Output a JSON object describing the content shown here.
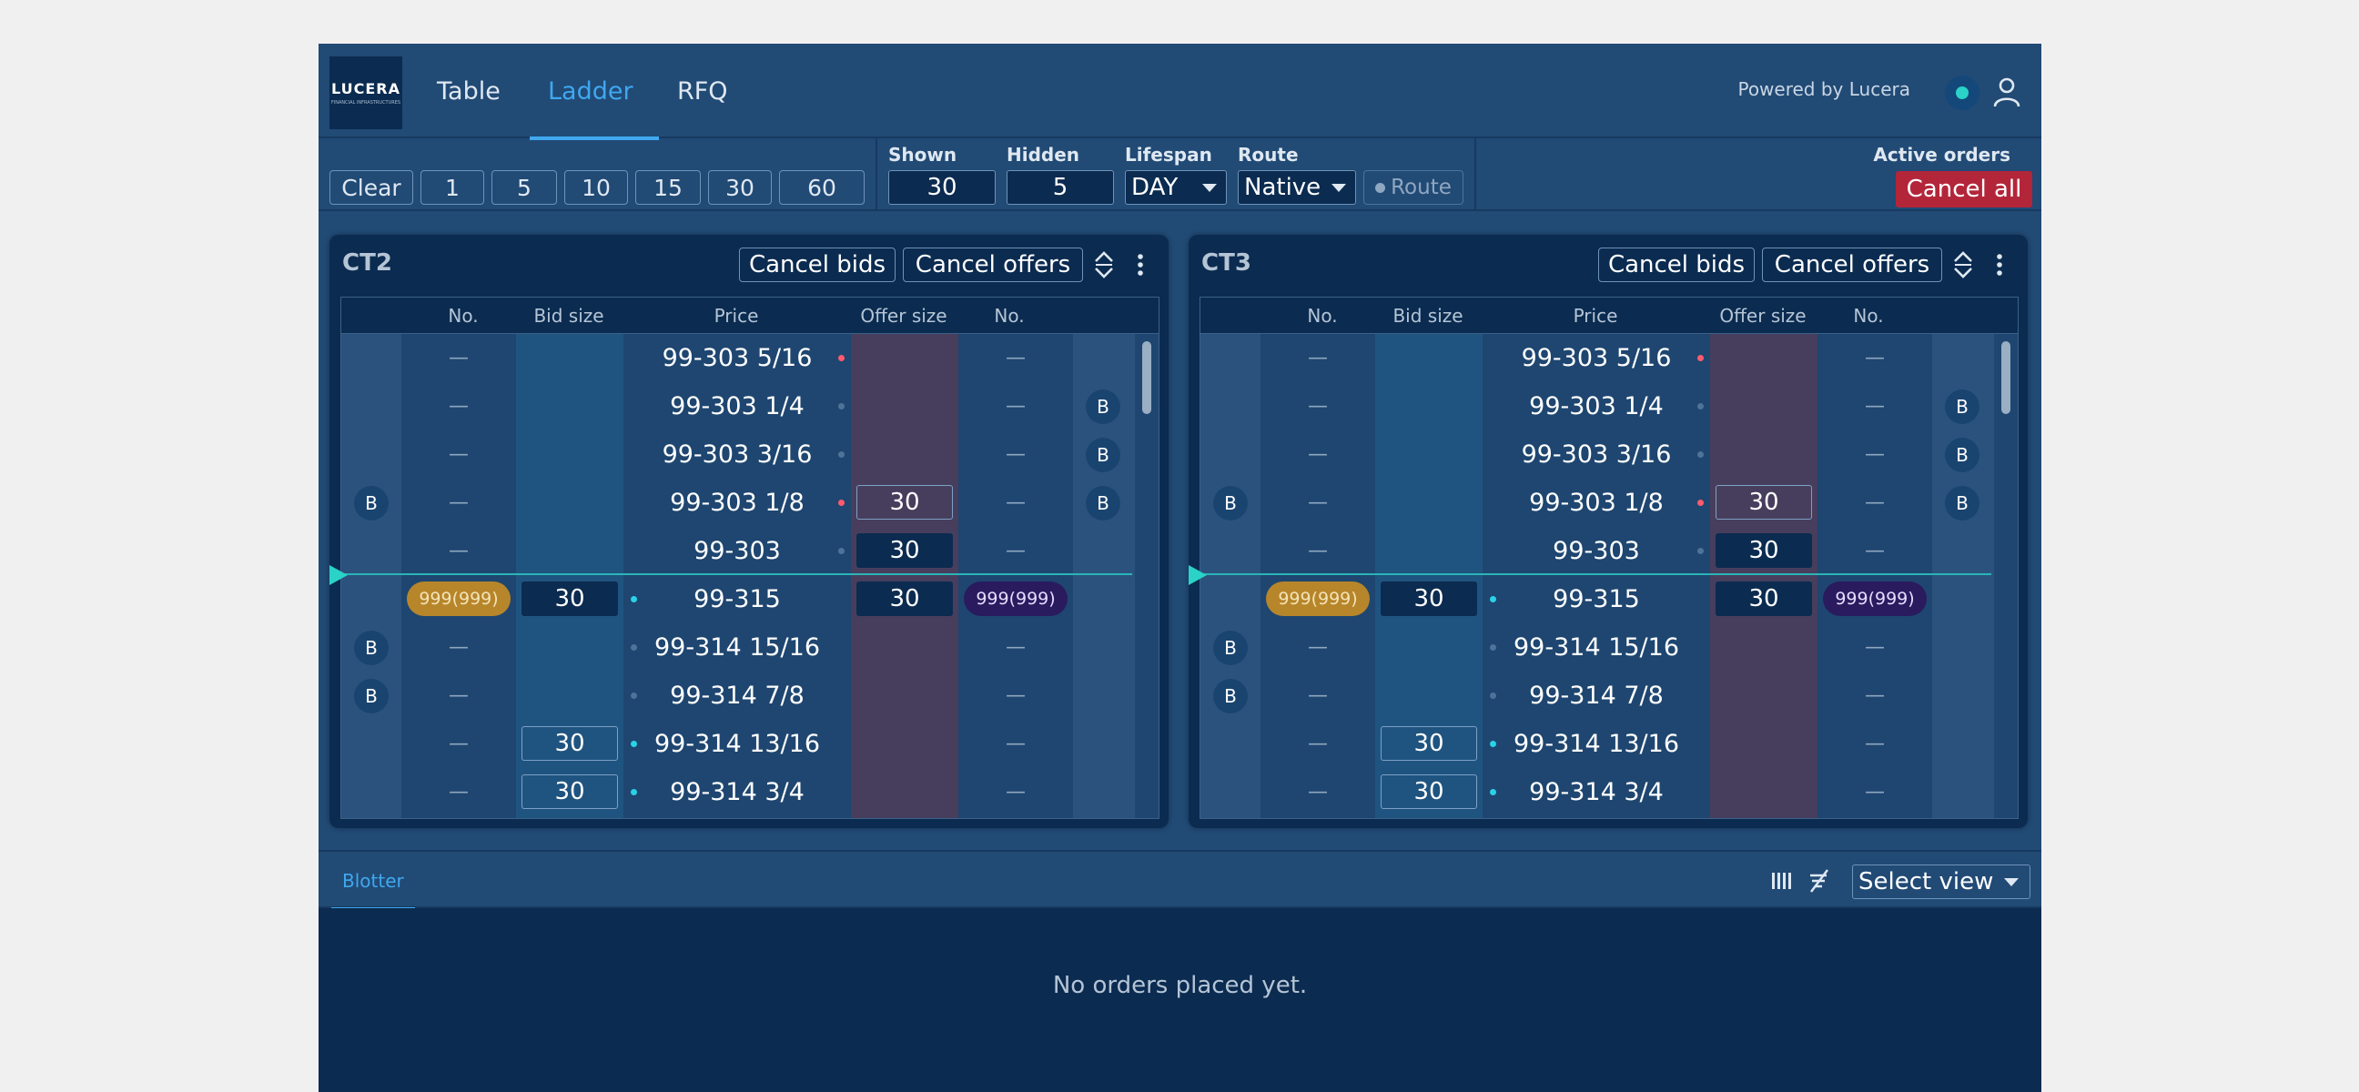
{
  "header": {
    "logo_text": "LUCERA",
    "logo_sub": "FINANCIAL INFRASTRUCTURES",
    "nav": [
      {
        "label": "Table"
      },
      {
        "label": "Ladder"
      },
      {
        "label": "RFQ"
      }
    ],
    "active_nav": "Ladder",
    "powered_by": "Powered by Lucera"
  },
  "toolbar": {
    "quick_sizes": [
      "Clear",
      "1",
      "5",
      "10",
      "15",
      "30",
      "60"
    ],
    "shown_label": "Shown",
    "shown_value": "30",
    "hidden_label": "Hidden",
    "hidden_value": "5",
    "lifespan_label": "Lifespan",
    "lifespan_value": "DAY",
    "route_label": "Route",
    "route_value": "Native",
    "route_button": "Route",
    "active_orders_label": "Active orders",
    "cancel_all": "Cancel all"
  },
  "ladder": {
    "columns": [
      "No.",
      "Bid size",
      "Price",
      "Offer size",
      "No."
    ],
    "cancel_bids": "Cancel bids",
    "cancel_offers": "Cancel offers",
    "panels": [
      {
        "title": "CT2"
      },
      {
        "title": "CT3"
      }
    ],
    "rows": [
      {
        "left_badge": "",
        "no_left": "—",
        "bid": "",
        "price": "99-303 5/16",
        "dot_side": "right",
        "dot_color": "#ff5a6e",
        "offer": "",
        "offer_style": "",
        "no_right": "—",
        "right_badge": ""
      },
      {
        "left_badge": "",
        "no_left": "—",
        "bid": "",
        "price": "99-303 1/4",
        "dot_side": "right",
        "dot_color": "#4f7398",
        "offer": "",
        "offer_style": "",
        "no_right": "—",
        "right_badge": "B"
      },
      {
        "left_badge": "",
        "no_left": "—",
        "bid": "",
        "price": "99-303 3/16",
        "dot_side": "right",
        "dot_color": "#4f7398",
        "offer": "",
        "offer_style": "",
        "no_right": "—",
        "right_badge": "B"
      },
      {
        "left_badge": "B",
        "no_left": "—",
        "bid": "",
        "price": "99-303 1/8",
        "dot_side": "right",
        "dot_color": "#ff5a6e",
        "offer": "30",
        "offer_style": "outline",
        "no_right": "—",
        "right_badge": "B"
      },
      {
        "left_badge": "",
        "no_left": "—",
        "bid": "",
        "price": "99-303",
        "dot_side": "right",
        "dot_color": "#4f7398",
        "offer": "30",
        "offer_style": "solid",
        "no_right": "—",
        "right_badge": ""
      },
      {
        "left_badge": "",
        "no_left": "999(999)",
        "bid": "30",
        "bid_style": "solid",
        "price": "99-315",
        "dot_side": "left",
        "dot_color": "#2bd2e7",
        "offer": "30",
        "offer_style": "solid",
        "no_right": "999(999)",
        "right_badge": "",
        "mid": true
      },
      {
        "left_badge": "B",
        "no_left": "—",
        "bid": "",
        "price": "99-314 15/16",
        "dot_side": "left",
        "dot_color": "#4f7398",
        "offer": "",
        "offer_style": "",
        "no_right": "—",
        "right_badge": ""
      },
      {
        "left_badge": "B",
        "no_left": "—",
        "bid": "",
        "price": "99-314 7/8",
        "dot_side": "left",
        "dot_color": "#4f7398",
        "offer": "",
        "offer_style": "",
        "no_right": "—",
        "right_badge": ""
      },
      {
        "left_badge": "",
        "no_left": "—",
        "bid": "30",
        "bid_style": "outline",
        "price": "99-314 13/16",
        "dot_side": "left",
        "dot_color": "#2bd2e7",
        "offer": "",
        "offer_style": "",
        "no_right": "—",
        "right_badge": ""
      },
      {
        "left_badge": "",
        "no_left": "—",
        "bid": "30",
        "bid_style": "outline",
        "price": "99-314 3/4",
        "dot_side": "left",
        "dot_color": "#2bd2e7",
        "offer": "",
        "offer_style": "",
        "no_right": "—",
        "right_badge": ""
      }
    ]
  },
  "blotter": {
    "tab": "Blotter",
    "select_view": "Select view",
    "empty_message": "No orders placed yet."
  },
  "colors": {
    "accent": "#3fa8ef",
    "cancel_all": "#b3263a",
    "bid_pill": "#b7862a",
    "offer_pill": "#2a1a5e",
    "bid_column": "#1f5480",
    "offer_column": "#473e5d"
  }
}
